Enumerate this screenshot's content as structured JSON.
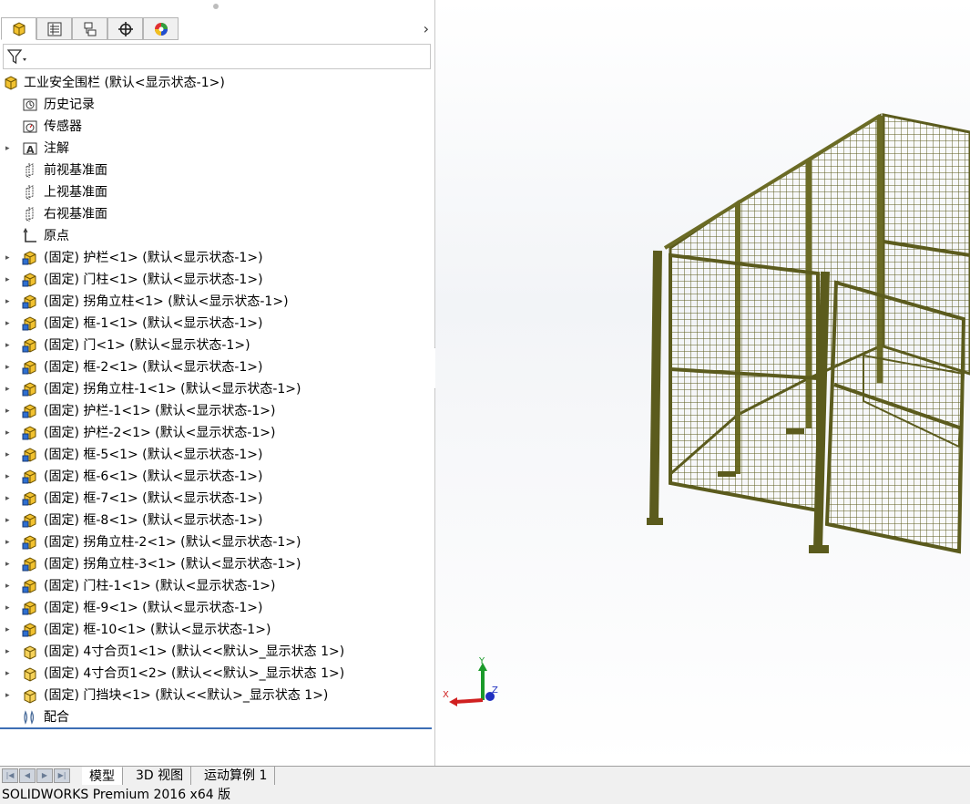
{
  "tabs": [
    {
      "name": "featuremanager-tab",
      "icon": "feature-manager-icon",
      "active": true
    },
    {
      "name": "propertymanager-tab",
      "icon": "property-manager-icon",
      "active": false
    },
    {
      "name": "configurationmanager-tab",
      "icon": "configuration-manager-icon",
      "active": false
    },
    {
      "name": "dimxpert-tab",
      "icon": "dimxpert-crosshair-icon",
      "active": false
    },
    {
      "name": "displaymanager-tab",
      "icon": "display-manager-icon",
      "active": false
    }
  ],
  "tree": {
    "root": {
      "label": "工业安全围栏  (默认<显示状态-1>)",
      "icon": "assembly-icon"
    },
    "items": [
      {
        "label": "历史记录",
        "icon": "history-icon",
        "expandable": false
      },
      {
        "label": "传感器",
        "icon": "sensor-icon",
        "expandable": false
      },
      {
        "label": "注解",
        "icon": "annotation-icon",
        "expandable": true
      },
      {
        "label": "前视基准面",
        "icon": "plane-icon",
        "expandable": false
      },
      {
        "label": "上视基准面",
        "icon": "plane-icon",
        "expandable": false
      },
      {
        "label": "右视基准面",
        "icon": "plane-icon",
        "expandable": false
      },
      {
        "label": "原点",
        "icon": "origin-icon",
        "expandable": false
      },
      {
        "label": "(固定) 护栏<1> (默认<显示状态-1>)",
        "icon": "subassembly-icon",
        "expandable": true
      },
      {
        "label": "(固定) 门柱<1> (默认<显示状态-1>)",
        "icon": "subassembly-icon",
        "expandable": true
      },
      {
        "label": "(固定) 拐角立柱<1> (默认<显示状态-1>)",
        "icon": "subassembly-icon",
        "expandable": true
      },
      {
        "label": "(固定) 框-1<1> (默认<显示状态-1>)",
        "icon": "subassembly-icon",
        "expandable": true
      },
      {
        "label": "(固定) 门<1> (默认<显示状态-1>)",
        "icon": "subassembly-icon",
        "expandable": true
      },
      {
        "label": "(固定) 框-2<1> (默认<显示状态-1>)",
        "icon": "subassembly-icon",
        "expandable": true
      },
      {
        "label": "(固定) 拐角立柱-1<1> (默认<显示状态-1>)",
        "icon": "subassembly-icon",
        "expandable": true
      },
      {
        "label": "(固定) 护栏-1<1> (默认<显示状态-1>)",
        "icon": "subassembly-icon",
        "expandable": true
      },
      {
        "label": "(固定) 护栏-2<1> (默认<显示状态-1>)",
        "icon": "subassembly-icon",
        "expandable": true
      },
      {
        "label": "(固定) 框-5<1> (默认<显示状态-1>)",
        "icon": "subassembly-icon",
        "expandable": true
      },
      {
        "label": "(固定) 框-6<1> (默认<显示状态-1>)",
        "icon": "subassembly-icon",
        "expandable": true
      },
      {
        "label": "(固定) 框-7<1> (默认<显示状态-1>)",
        "icon": "subassembly-icon",
        "expandable": true
      },
      {
        "label": "(固定) 框-8<1> (默认<显示状态-1>)",
        "icon": "subassembly-icon",
        "expandable": true
      },
      {
        "label": "(固定) 拐角立柱-2<1> (默认<显示状态-1>)",
        "icon": "subassembly-icon",
        "expandable": true
      },
      {
        "label": "(固定) 拐角立柱-3<1> (默认<显示状态-1>)",
        "icon": "subassembly-icon",
        "expandable": true
      },
      {
        "label": "(固定) 门柱-1<1> (默认<显示状态-1>)",
        "icon": "subassembly-icon",
        "expandable": true
      },
      {
        "label": "(固定) 框-9<1> (默认<显示状态-1>)",
        "icon": "subassembly-icon",
        "expandable": true
      },
      {
        "label": "(固定) 框-10<1> (默认<显示状态-1>)",
        "icon": "subassembly-icon",
        "expandable": true
      },
      {
        "label": "(固定) 4寸合页1<1> (默认<<默认>_显示状态 1>)",
        "icon": "part-icon",
        "expandable": true
      },
      {
        "label": "(固定) 4寸合页1<2> (默认<<默认>_显示状态 1>)",
        "icon": "part-icon",
        "expandable": true
      },
      {
        "label": "(固定) 门挡块<1> (默认<<默认>_显示状态 1>)",
        "icon": "part-icon",
        "expandable": true
      },
      {
        "label": "配合",
        "icon": "mates-icon",
        "expandable": false
      }
    ]
  },
  "bottom_tabs": [
    {
      "label": "模型",
      "active": true
    },
    {
      "label": "3D 视图",
      "active": false
    },
    {
      "label": "运动算例 1",
      "active": false
    }
  ],
  "status": {
    "text": "SOLIDWORKS Premium 2016 x64 版"
  },
  "triad": {
    "x": "X",
    "y": "Y",
    "z": "Z"
  },
  "colors": {
    "fence": "#5b5b1d",
    "fence_light": "#8a8a3c",
    "selection_line": "#3c6eb4",
    "axis_x": "#d02020",
    "axis_y": "#1a9a2a",
    "axis_z": "#2030c0"
  }
}
